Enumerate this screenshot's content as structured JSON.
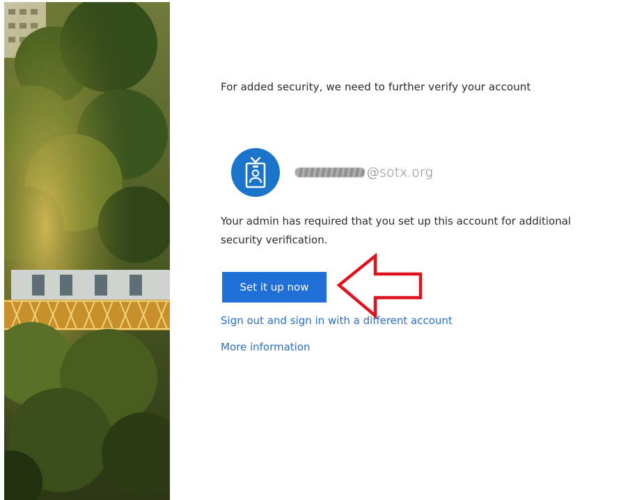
{
  "prompt": {
    "heading": "For added security, we need to further verify your account",
    "email_domain": "@sotx.org",
    "description": "Your admin has required that you set up this account for additional security verification.",
    "primary_button_label": "Set it up now",
    "signout_link_label": "Sign out and sign in with a different account",
    "more_info_link_label": "More information"
  },
  "icons": {
    "avatar": "id-badge-icon",
    "annotation": "red-arrow-icon"
  },
  "colors": {
    "primary_button": "#1f6fd6",
    "link": "#2a6fc0",
    "avatar_background": "#1a74c9",
    "annotation_arrow": "#e0121e"
  }
}
